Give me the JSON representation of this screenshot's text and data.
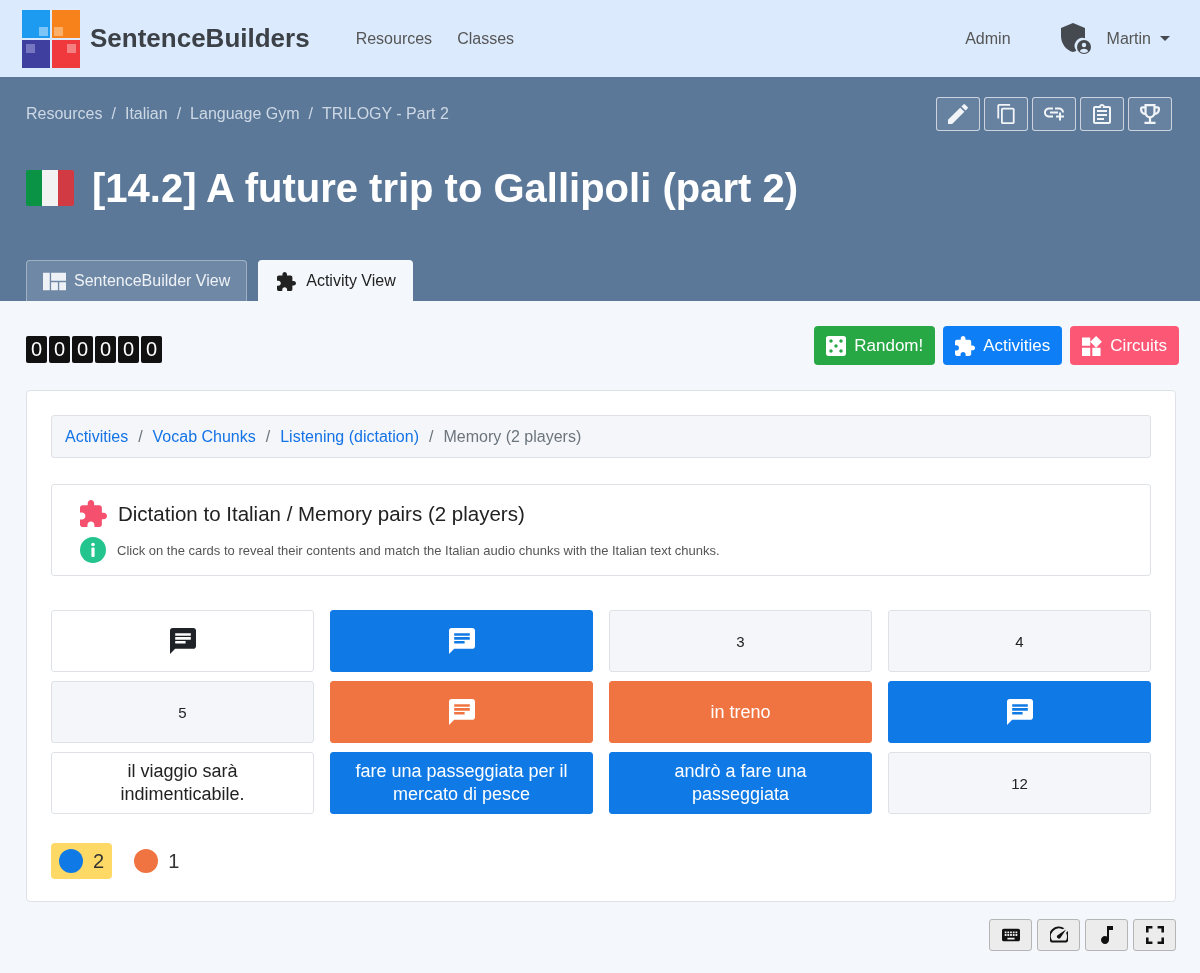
{
  "navbar": {
    "brand": "SentenceBuilders",
    "links": [
      {
        "label": "Resources"
      },
      {
        "label": "Classes"
      }
    ],
    "admin": "Admin",
    "user": "Martin"
  },
  "banner": {
    "breadcrumb": [
      {
        "label": "Resources",
        "separator": "/"
      },
      {
        "label": "Italian",
        "separator": "/"
      },
      {
        "label": "Language Gym",
        "separator": "/"
      },
      {
        "label": "TRILOGY - Part 2"
      }
    ],
    "title": "[14.2] A future trip to Gallipoli (part 2)",
    "tabs": [
      {
        "label": "SentenceBuilder View",
        "selected": false
      },
      {
        "label": "Activity View",
        "selected": true
      }
    ]
  },
  "toolbar": {
    "counter": [
      "0",
      "0",
      "0",
      "0",
      "0",
      "0"
    ],
    "buttons": [
      {
        "label": "Random!",
        "color": "#28a745"
      },
      {
        "label": "Activities",
        "color": "#0d7ef5"
      },
      {
        "label": "Circuits",
        "color": "#fc5876"
      }
    ]
  },
  "activity": {
    "breadcrumb": [
      {
        "label": "Activities",
        "current": false,
        "separator": "/"
      },
      {
        "label": "Vocab Chunks",
        "current": false,
        "separator": "/"
      },
      {
        "label": "Listening (dictation)",
        "current": false,
        "separator": "/"
      },
      {
        "label": "Memory (2 players)",
        "current": true
      }
    ],
    "heading": "Dictation to Italian / Memory pairs (2 players)",
    "instructions": "Click on the cards to reveal their contents and match the Italian audio chunks with the Italian text chunks.",
    "cards": [
      {
        "kind": "audio"
      },
      {
        "kind": "audio",
        "color": "#0f7ae5"
      },
      {
        "kind": "hidden",
        "label": "3"
      },
      {
        "kind": "hidden",
        "label": "4"
      },
      {
        "kind": "hidden",
        "label": "5"
      },
      {
        "kind": "audio",
        "color": "#f07441"
      },
      {
        "kind": "text",
        "label": "in treno",
        "color": "#f07441"
      },
      {
        "kind": "audio",
        "color": "#0f7ae5"
      },
      {
        "kind": "text",
        "label": "il viaggio sarà indimenticabile."
      },
      {
        "kind": "text",
        "label": "fare una passeggiata per il mercato di pesce",
        "color": "#0f7ae5"
      },
      {
        "kind": "text",
        "label": "andrò a fare una passeggiata",
        "color": "#0f7ae5"
      },
      {
        "kind": "hidden",
        "label": "12"
      }
    ],
    "players": [
      {
        "color": "#0f7ae5",
        "score": "2",
        "selected": true
      },
      {
        "color": "#f07441",
        "score": "1",
        "selected": false
      }
    ]
  }
}
